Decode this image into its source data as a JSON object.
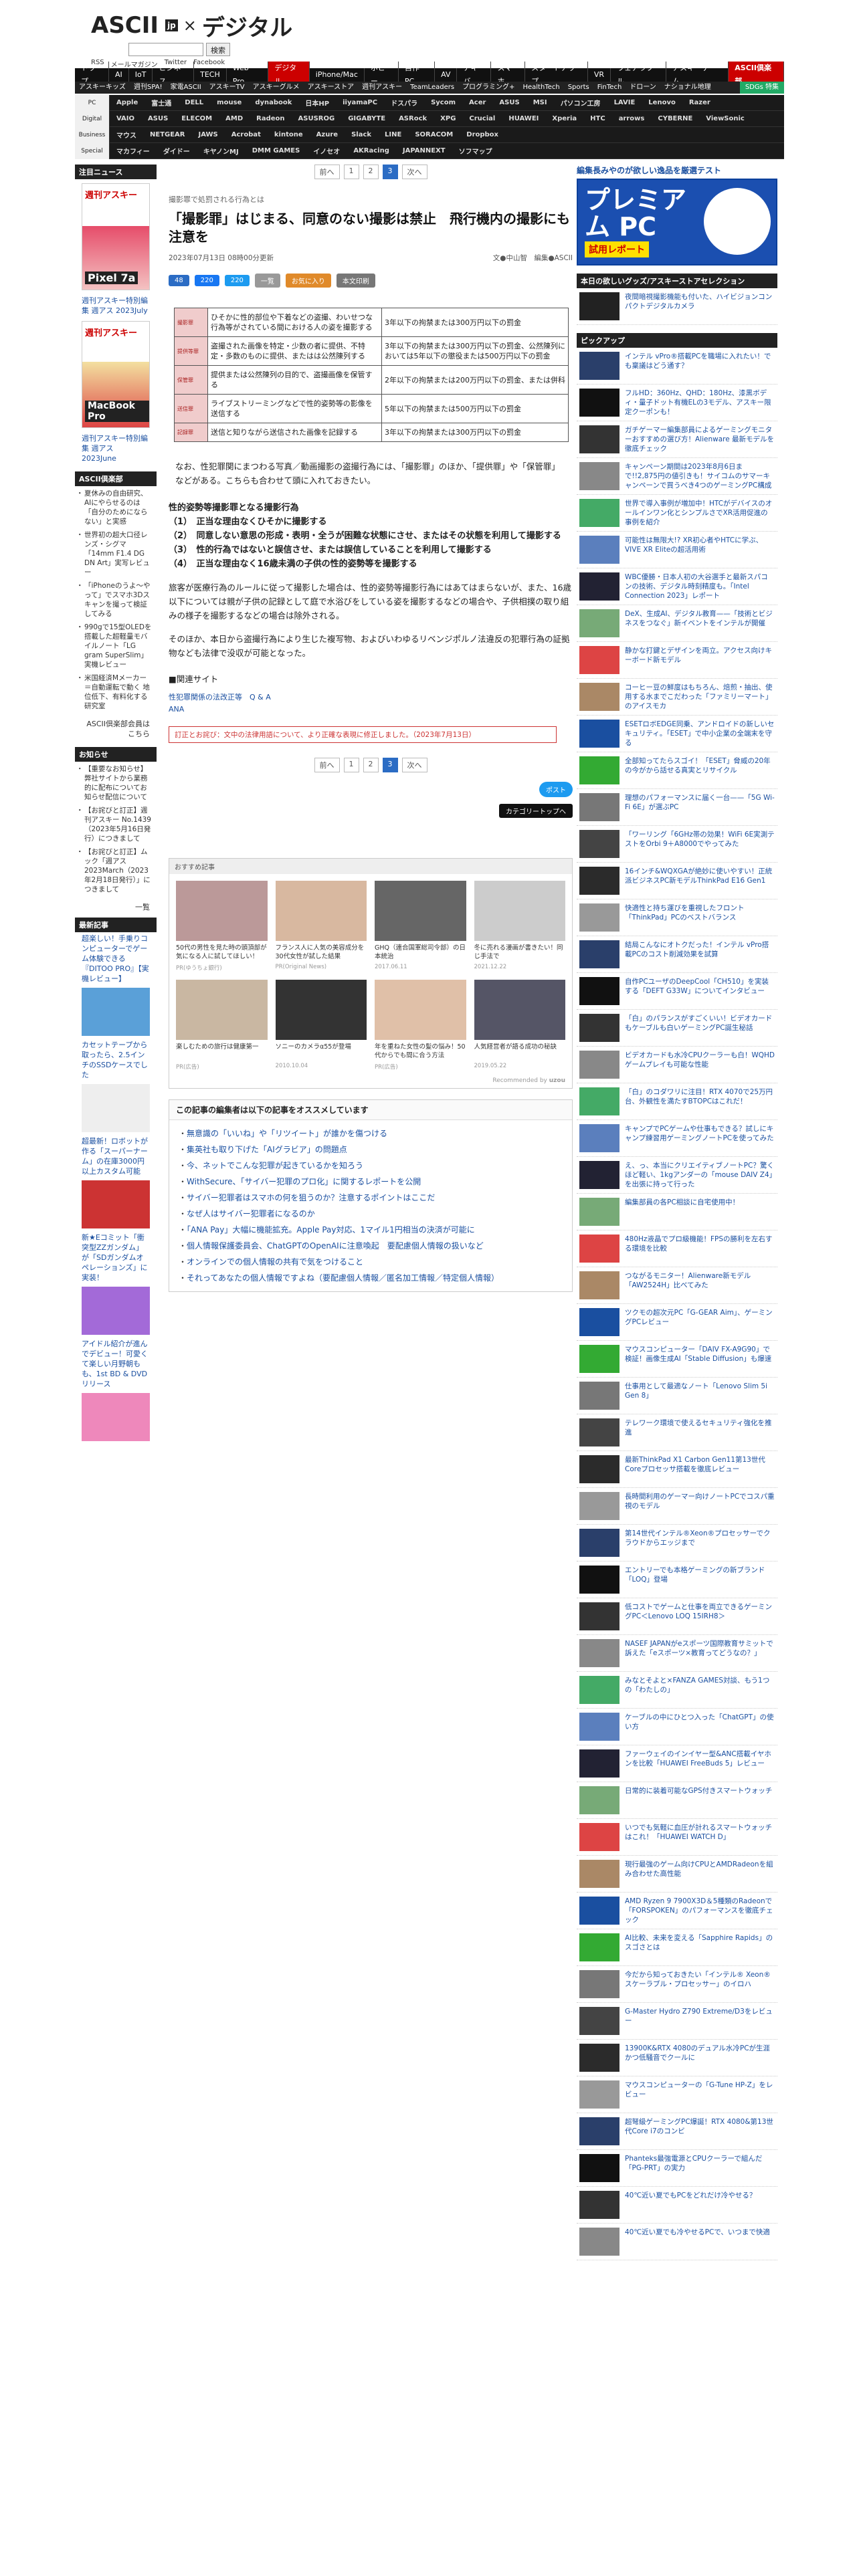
{
  "header": {
    "logo_main": "ASCII",
    "logo_jp": "jp",
    "logo_x": "×",
    "logo_sub": "デジタル",
    "search_button": "検索",
    "sublinks": [
      "RSS",
      "メールマガジン",
      "Twitter",
      "Facebook"
    ]
  },
  "nav": {
    "primary": [
      "トップ",
      "AI",
      "IoT",
      "ビジネス",
      "TECH",
      "Web Pro",
      "デジタル",
      "iPhone/Mac",
      "ホビー",
      "自作PC",
      "AV",
      "アキバ",
      "スマホ",
      "スタートアップ",
      "VR",
      "ウェアラブル",
      "アスキーゲーム"
    ],
    "primary_active": "デジタル",
    "primary_right": "ASCII倶楽部",
    "secondary": [
      "アスキーキッズ",
      "週刊SPA!",
      "家電ASCII",
      "アスキーTV",
      "アスキーグルメ",
      "アスキーストア",
      "週刊アスキー",
      "TeamLeaders",
      "プログラミング+",
      "HealthTech",
      "Sports",
      "FinTech",
      "ドローン",
      "ナショナル地理"
    ],
    "secondary_right": "SDGs 特集",
    "brand_rows": [
      {
        "label": "PC",
        "items": [
          "Apple",
          "富士通",
          "DELL",
          "mouse",
          "dynabook",
          "日本HP",
          "iiyamaPC",
          "ドスパラ",
          "Sycom",
          "Acer",
          "ASUS",
          "MSI",
          "パソコン工房",
          "LAVIE",
          "Lenovo",
          "Razer"
        ]
      },
      {
        "label": "Digital",
        "items": [
          "VAIO",
          "ASUS",
          "ELECOM",
          "AMD",
          "Radeon",
          "ASUSROG",
          "GIGABYTE",
          "ASRock",
          "XPG",
          "Crucial",
          "HUAWEI",
          "Xperia",
          "HTC",
          "arrows",
          "CYBERNE",
          "ViewSonic"
        ]
      },
      {
        "label": "Business",
        "items": [
          "マウス",
          "NETGEAR",
          "JAWS",
          "Acrobat",
          "kintone",
          "Azure",
          "Slack",
          "LINE",
          "SORACOM",
          "Dropbox"
        ]
      },
      {
        "label": "Special",
        "items": [
          "マカフィー",
          "ダイドー",
          "キヤノンMJ",
          "DMM GAMES",
          "イノセオ",
          "AKRacing",
          "JAPANNEXT",
          "ソフマップ"
        ]
      }
    ]
  },
  "left_sidebar": {
    "notice_head": "注目ニュース",
    "mag1_title": "週刊アスキー特別編集 週アス 2023July",
    "mag1_cover_text": "週刊アスキー",
    "mag1_cover_sub": "Pixel 7a",
    "mag2_title": "週刊アスキー特別編集 週アス 2023June",
    "mag2_cover_text": "週刊アスキー",
    "mag2_cover_sub": "MacBook Pro",
    "club_head": "ASCII倶楽部",
    "club_items": [
      "夏休みの自由研究、AIにやらせるのは「自分のためにならない」と実感",
      "世界初の超大口径レンズ・シグマ「14mm F1.4 DG DN Art」実写レビュー",
      "「iPhoneのうよ～やって」でスマホ3Dスキャンを撮って検証してみる",
      "990gで15型OLEDを搭載した超軽量モバイルノート「LG gram SuperSlim」実機レビュー",
      "米国経済Mメーカー＝自動運転で動く 地位低下、有料化する研究室"
    ],
    "club_more": "ASCII倶楽部会員はこちら",
    "info_head": "お知らせ",
    "info_items": [
      "【重要なお知らせ】弊社サイトから業務的に配布についてお知らせ配信について",
      "【お詫びと訂正】週刊アスキー No.1439（2023年5月16日発行）につきまして",
      "【お詫びと訂正】ムック「週アス2023March（2023年2月18日発行）」につきまして"
    ],
    "info_more": "一覧",
    "pickup_head": "最新記事",
    "pickups": [
      "超楽しい！手乗りコンピューターでゲーム体験できる『DITOO PRO』【実機レビュー】",
      "カセットテープから取ったら、2.5インチのSSDケースでした",
      "超最新！ロボットが作る「スーパーナーム」の在庫3000円以上カスタム可能",
      "新★Eコミット「衝突型ZZガンダム」が「SDガンダムオペレーションズ」に実装！",
      "アイドル紹介が進んでデビュー！可愛くて楽しい月野朝もも、1st BD & DVDリリース"
    ]
  },
  "article": {
    "pager": {
      "prev": "前へ",
      "pages": [
        "1",
        "2",
        "3"
      ],
      "current": "3",
      "next": "次へ"
    },
    "kicker": "撮影罪で処罰される行為とは",
    "title": "「撮影罪」はじまる、同意のない撮影は禁止　飛行機内の撮影にも注意を",
    "date": "2023年07月13日 08時00分更新",
    "byline": "文●中山智　編集●ASCII",
    "share": [
      {
        "label": "48",
        "color": "#2b6cc4"
      },
      {
        "label": "220",
        "color": "#1877f2"
      },
      {
        "label": "220",
        "color": "#1d9bf0"
      },
      {
        "label": "一覧",
        "color": "#999"
      },
      {
        "label": "お気に入り",
        "color": "#e08a2a"
      },
      {
        "label": "本文印刷",
        "color": "#777"
      }
    ],
    "intro": "なお、性犯罪関にまつわる写真／動画撮影の盗撮行為には、「撮影罪」のほか、「提供罪」や「保管罪」などがある。こちらも合わせて頭に入れておきたい。",
    "table": [
      {
        "label": "撮影罪",
        "act": "ひそかに性的部位や下着などの盗撮、わいせつな行為等がされている間における人の姿を撮影する",
        "penalty": "3年以下の拘禁または300万円以下の罰金"
      },
      {
        "label": "提供等罪",
        "act": "盗撮された画像を特定・少数の者に提供、不特定・多数のものに提供、またはは公然陳列する",
        "penalty": "3年以下の拘禁または300万円以下の罰金、公然陳列においては5年以下の懲役または500万円以下の罰金"
      },
      {
        "label": "保管罪",
        "act": "提供または公然陳列の目的で、盗撮画像を保管する",
        "penalty": "2年以下の拘禁または200万円以下の罰金、または併科"
      },
      {
        "label": "送信罪",
        "act": "ライブストリーミングなどで性的姿勢等の影像を送信する",
        "penalty": "5年以下の拘禁または500万円以下の罰金"
      },
      {
        "label": "記録罪",
        "act": "送信と知りながら送信された画像を記録する",
        "penalty": "3年以下の拘禁または300万円以下の罰金"
      }
    ],
    "section_title": "性的姿勢等撮影罪となる撮影行為",
    "section_items": [
      "（1）　正当な理由なくひそかに撮影する",
      "（2）　同意しない意思の形成・表明・全うが困難な状態にさせ、またはその状態を利用して撮影する",
      "（3）　性的行為ではないと誤信させ、または誤信していることを利用して撮影する",
      "（4）　正当な理由なく16歳未満の子供の性的姿勢等を撮影する"
    ],
    "para1": "旅客が医療行為のルールに従って撮影した場合は、性的姿勢等撮影行為にはあてはまらないが、また、16歳以下については親が子供の記録として庭で水浴びをしている姿を撮影するなどの場合や、子供相撲の取り組みの様子を撮影するなどの場合は除外される。",
    "para2": "そのほか、本日から盗撮行為により生じた複写物、およびいわゆるリベンジポルノ法違反の犯罪行為の証拠物なども法律で没収が可能となった。",
    "related_head": "■関連サイト",
    "related": [
      "性犯罪関係の法改正等　Q & A",
      "ANA"
    ],
    "correction": "訂正とお詫び：文中の法律用語について、より正確な表現に修正しました。（2023年7月13日）",
    "tweet_label": "ポスト",
    "category_label": "カテゴリートップへ",
    "rec_head": "おすすめ記事",
    "rec": [
      {
        "t": "50代の男性を見た時の頭頂部が気になる人に試してほしい！",
        "s": "PR(ゆうちょ銀行)"
      },
      {
        "t": "フランス人に人気の美容成分を30代女性が試した結果",
        "s": "PR(Original News)"
      },
      {
        "t": "GHQ（連合国軍総司令部）の日本統治",
        "s": "2017.06.11"
      },
      {
        "t": "冬に売れる漫画が書きたい！同じ手法で",
        "s": "2021.12.22"
      },
      {
        "t": "楽しむための旅行は健康第一",
        "s": "PR(広告)"
      },
      {
        "t": "ソニーのカメラα55が登場",
        "s": "2010.10.04"
      },
      {
        "t": "年を重ねた女性の髪の悩み！50代からでも間に合う方法",
        "s": "PR(広告)"
      },
      {
        "t": "人気経営者が語る成功の秘訣",
        "s": "2019.05.22"
      }
    ],
    "rec_foot": "Recommended by",
    "oss_head": "この記事の編集者は以下の記事をオススメしています",
    "oss": [
      "無意識の「いいね」や「リツイート」が誰かを傷つける",
      "集英社も取り下げた「AIグラビア」の問題点",
      "今、ネットでこんな犯罪が起きているかを知ろう",
      "WithSecure、「サイバー犯罪のプロ化」に関するレポートを公開",
      "サイバー犯罪者はスマホの何を狙うのか？注意するポイントはここだ",
      "なぜ人はサイバー犯罪者になるのか",
      "「ANA Pay」大幅に機能拡充。Apple Pay対応、1マイル1円相当の決済が可能に",
      "個人情報保護委員会、ChatGPTのOpenAIに注意喚起　要配慮個人情報の扱いなど",
      "オンラインでの個人情報の共有で気をつけること",
      "それってあなたの個人情報ですよね（要配慮個人情報／匿名加工情報／特定個人情報）"
    ]
  },
  "right_sidebar": {
    "banner_top": "編集長みやのが欲しい逸品を厳選テスト",
    "banner_main": "プレミアム PC",
    "banner_sub": "試用レポート",
    "recommend_head": "本日の欲しいグッズ/アスキーストアセレクション",
    "recommend_item": "夜間暗視撮影機能も付いた、ハイビジョンコンパクトデジタルカメラ",
    "pickup_head": "ピックアップ",
    "items": [
      "インテル vPro®搭載PCを職場に入れたい！でも稟議はどう通す？",
      "フルHD：360Hz、QHD：180Hz、漆黒ボディ・量子ドット有機ELの3モデル、アスキー限定クーポンも！",
      "ガチゲーマー編集部員によるゲーミングモニターおすすめの選び方！Alienware 最新モデルを徹底チェック",
      "キャンペーン期間は2023年8月6日まで!!2,875円の値引きも！サイコムのサマーキャンペーンで買うべき4つのゲーミングPC構成",
      "世界で導入事例が増加中！HTCがデバイスのオールインワン化とシンプルさでXR活用促進の事例を紹介",
      "可能性は無限大!? XR初心者やHTCに学ぶ、VIVE XR Eliteの超活用術",
      "WBC優勝・日本人初の大谷選手と最新スパコンの技術、デジタル時刻精度も。「Intel Connection 2023」レポート",
      "DeX、生成AI、デジタル教育——「技術とビジネスをつなぐ」新イベントをインテルが開催",
      "静かな打鍵とデザインを両立。アクセス向けキーボード新モデル",
      "コーヒー豆の鮮度はもちろん、焙煎・抽出、使用する水までこだわった「ファミリーマート」のアイスモカ",
      "ESETロボEDGE同乗、アンドロイドの新しいセキュリティ。「ESET」で中小企業の全端末を守る",
      "全部知ってたらスゴイ！「ESET」脅威の20年の今がから話せる真実とリサイクル",
      "理想のパフォーマンスに届く一台——「5G Wi-Fi 6E」が選ぶPC",
      "「ワーリング「6GHz帯の効果！WiFi 6E実測テストをOrbi 9＋A8000でやってみた",
      "16インチ&WQXGAが絶妙に使いやすい！正統派ビジネスPC新モデルThinkPad E16 Gen1",
      "快適性と持ち運びを重視したフロント「ThinkPad」PCのベストバランス",
      "結局こんなにオトクだった！インテル vPro搭載PCのコスト削減効果を試算",
      "自作PCユーザのDeepCool「CH510」を実装する「DEFT G33W」についてインタビュー",
      "「白」のパランスがすごくいい！ビデオカードもケーブルも白いゲーミングPC誕生秘話",
      "ビデオカードも水冷CPUクーラーも白！WQHDゲームプレイも可能な性能",
      "「白」のコダワリに注目！RTX 4070で25万円台、外観性を満たすBTOPCはこれだ！",
      "キャンプでPCゲームや仕事もできる？試しにキャンプ練習用ゲーミングノートPCを使ってみた",
      "え、っ、本当にクリエイティブノートPC？驚くほど軽い、1kgアンダーの「mouse DAIV Z4」を出張に持って行った",
      "編集部員の各PC相談に自宅使用中！",
      "480Hz液晶でプロ級機能！FPSの勝利を左右する環境を比較",
      "つながるモニター！Alienware新モデル「AW2524H」比べてみた",
      "ツクモの超次元PC「G-GEAR Aim」、ゲーミングPCレビュー",
      "マウスコンピューター「DAIV FX-A9G90」で検証！画像生成AI「Stable Diffusion」も爆速",
      "仕事用として最適なノート「Lenovo Slim 5i Gen 8」",
      "テレワーク環境で使えるセキュリティ強化を推進",
      "最新ThinkPad X1 Carbon Gen11第13世代Coreプロセッサ搭載を徹底レビュー",
      "長時間利用のゲーマー向けノートPCでコスパ重視のモデル",
      "第14世代インテル®Xeon®プロセッサーでクラウドからエッジまで",
      "エントリーでも本格ゲーミングの新ブランド「LOQ」登場",
      "低コストでゲームと仕事を両立できるゲーミングPC＜Lenovo LOQ 15IRH8＞",
      "NASEF JAPANがeスポーツ国際教育サミットで訴えた「eスポーツ×教育ってどうなの？」",
      "みなとそよと×FANZA GAMES対談、もう1つの「わたしの」",
      "ケーブルの中にひとつ入った「ChatGPT」の使い方",
      "ファーウェイのインイヤー型&ANC搭載イヤホンを比較「HUAWEI FreeBuds 5」レビュー",
      "日常的に装着可能なGPS付きスマートウォッチ",
      "いつでも気軽に血圧が計れるスマートウォッチはこれ！「HUAWEI WATCH D」",
      "現行最強のゲーム向けCPUとAMDRadeonを組み合わせた高性能",
      "AMD Ryzen 9 7900X3D＆5種類のRadeonで「FORSPOKEN」のパフォーマンスを徹底チェック",
      "AI比較、未来を変える「Sapphire Rapids」のスゴさとは",
      "今だから知っておきたい「インテル® Xeon® スケーラブル・プロセッサー」のイロハ",
      "G-Master Hydro Z790 Extreme/D3をレビュー",
      "13900K&RTX 4080のデュアル水冷PCが生涯かつ低騒音でクールに",
      "マウスコンピューターの「G-Tune HP-Z」をレビュー",
      "超弩級ゲーミングPC爆誕！RTX 4080&第13世代Core i7のコンビ",
      "Phanteks最強電源とCPUクーラーで組んだ「PG-PRT」の実力",
      "40℃近い夏でもPCをどれだけ冷やせる？",
      "40℃近い夏でも冷やせるPCで、いつまで快適"
    ]
  },
  "colors": {
    "accent": "#c00",
    "link": "#1a4fa0",
    "nav_bg": "#111",
    "active_tab": "#c00"
  }
}
